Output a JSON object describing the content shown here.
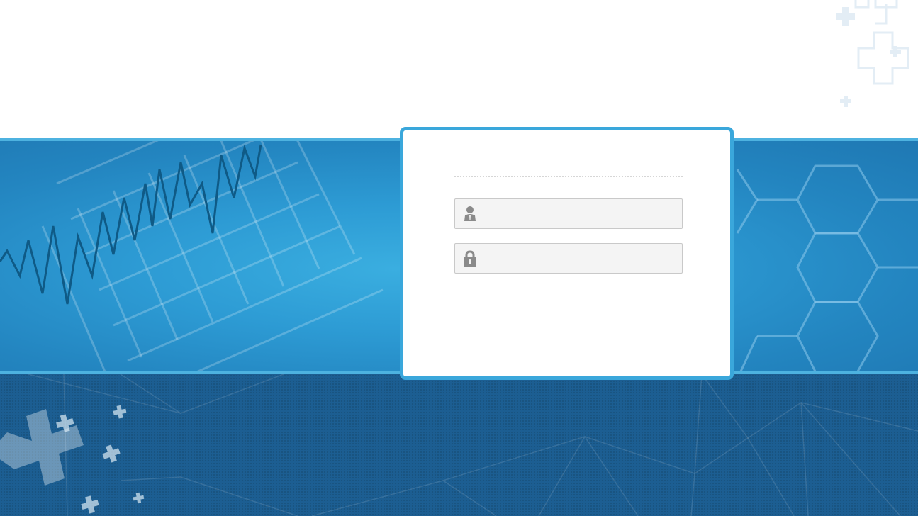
{
  "login": {
    "username": {
      "value": "",
      "placeholder": "",
      "icon": "user-icon"
    },
    "password": {
      "value": "",
      "placeholder": "",
      "icon": "lock-icon"
    }
  },
  "colors": {
    "band": "#2d9bd4",
    "band_border": "#4db2e0",
    "card_border": "#3aa7db",
    "bottom": "#1c5e92",
    "field_bg": "#f4f4f4",
    "field_border": "#c9c9c9",
    "icon": "#8a8a8a"
  }
}
